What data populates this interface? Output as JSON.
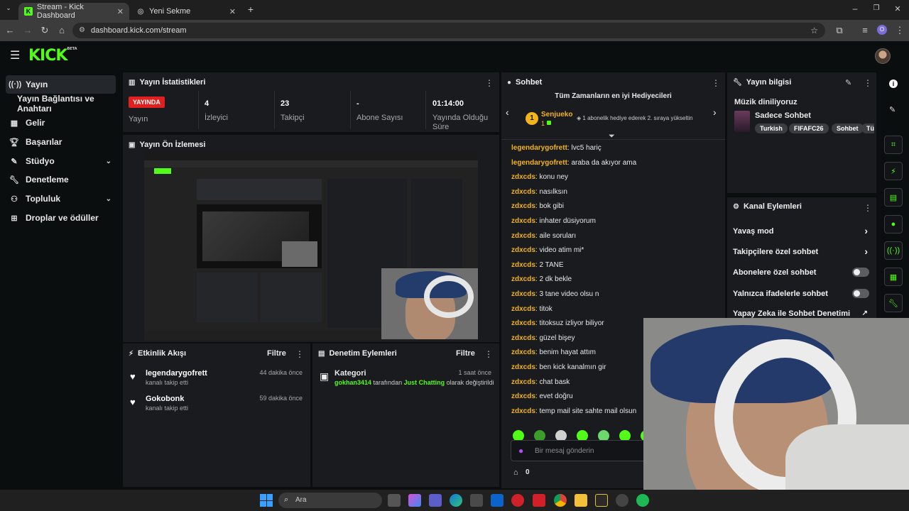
{
  "browser": {
    "tabs": [
      {
        "title": "Stream - Kick Dashboard",
        "active": true
      },
      {
        "title": "Yeni Sekme",
        "active": false
      }
    ],
    "url": "dashboard.kick.com/stream",
    "profile_letter": "O"
  },
  "brand": {
    "logo": "KICK",
    "badge": "BETA",
    "accent": "#53fc18"
  },
  "sidebar": {
    "items": [
      {
        "label": "Yayın",
        "icon": "broadcast-icon"
      },
      {
        "label": "Yayın Bağlantısı ve Anahtarı",
        "icon": ""
      },
      {
        "label": "Gelir",
        "icon": "chart-icon"
      },
      {
        "label": "Başarılar",
        "icon": "trophy-icon"
      },
      {
        "label": "Stüdyo",
        "icon": "studio-icon"
      },
      {
        "label": "Denetleme",
        "icon": "wrench-icon"
      },
      {
        "label": "Topluluk",
        "icon": "community-icon"
      },
      {
        "label": "Droplar ve ödüller",
        "icon": "gift-icon"
      }
    ]
  },
  "stats": {
    "title": "Yayın İstatistikleri",
    "live_badge": "YAYINDA",
    "live_label": "Yayın",
    "viewers_value": "4",
    "viewers_label": "İzleyici",
    "followers_value": "23",
    "followers_label": "Takipçi",
    "subs_value": "-",
    "subs_label": "Abone Sayısı",
    "uptime_value": "01:14:00",
    "uptime_label": "Yayında Olduğu Süre"
  },
  "preview": {
    "title": "Yayın Ön İzlemesi"
  },
  "events": {
    "title": "Etkinlik Akışı",
    "filter": "Filtre",
    "rows": [
      {
        "name": "legendarygofrett",
        "sub": "kanalı takip etti",
        "time": "44 dakika önce"
      },
      {
        "name": "Gokobonk",
        "sub": "kanalı takip etti",
        "time": "59 dakika önce"
      }
    ]
  },
  "modactions": {
    "title": "Denetim Eylemleri",
    "filter": "Filtre",
    "row": {
      "name": "Kategori",
      "time": "1 saat önce",
      "user": "gokhan3414",
      "mid": "tarafından",
      "category": "Just Chatting",
      "end": "olarak değiştirildi"
    }
  },
  "chat": {
    "title": "Sohbet",
    "top_gifters_title": "Tüm Zamanların en iyi Hediyecileri",
    "rank": "1",
    "gifter_name": "Senjueko",
    "gifter_count": "1",
    "gifter_note": "1 abonelik hediye ederek 2. sıraya yükseltin",
    "messages": [
      {
        "user": "legendarygofrett",
        "text": "lvc5 hariç"
      },
      {
        "user": "legendarygofrett",
        "text": "araba da akıyor ama"
      },
      {
        "user": "zdxcds",
        "text": "konu ney"
      },
      {
        "user": "zdxcds",
        "text": "nasılksın"
      },
      {
        "user": "zdxcds",
        "text": "bok gibi"
      },
      {
        "user": "zdxcds",
        "text": "inhater düsiyorum"
      },
      {
        "user": "zdxcds",
        "text": "aile soruları"
      },
      {
        "user": "zdxcds",
        "text": "video atim mi*"
      },
      {
        "user": "zdxcds",
        "text": "2 TANE"
      },
      {
        "user": "zdxcds",
        "text": "2 dk bekle"
      },
      {
        "user": "zdxcds",
        "text": "3 tane video olsu n"
      },
      {
        "user": "zdxcds",
        "text": "titok"
      },
      {
        "user": "zdxcds",
        "text": "titoksuz izliyor biliyor"
      },
      {
        "user": "zdxcds",
        "text": "güzel bişey"
      },
      {
        "user": "zdxcds",
        "text": "benim hayat attım"
      },
      {
        "user": "zdxcds",
        "text": "ben kick kanalmın gir"
      },
      {
        "user": "zdxcds",
        "text": "chat bask"
      },
      {
        "user": "zdxcds",
        "text": "evet doğru"
      },
      {
        "user": "zdxcds",
        "text": "temp mail site sahte mail olsun"
      }
    ],
    "input_placeholder": "Bir mesaj gönderin",
    "points": "0"
  },
  "stream_info": {
    "title": "Yayın bilgisi",
    "stream_title": "Müzik diniliyoruz",
    "category": "Sadece Sohbet",
    "tags": [
      "Turkish",
      "FIFAFC26",
      "Sohbet",
      "Türk"
    ]
  },
  "channel_actions": {
    "title": "Kanal Eylemleri",
    "rows": [
      {
        "label": "Yavaş mod",
        "control": "chevron"
      },
      {
        "label": "Takipçilere özel sohbet",
        "control": "chevron"
      },
      {
        "label": "Abonelere özel sohbet",
        "control": "toggle"
      },
      {
        "label": "Yalnızca ifadelerle sohbet",
        "control": "toggle"
      },
      {
        "label": "Yapay Zeka ile Sohbet Denetimi",
        "control": "external"
      }
    ]
  },
  "taskbar": {
    "search": "Ara"
  }
}
